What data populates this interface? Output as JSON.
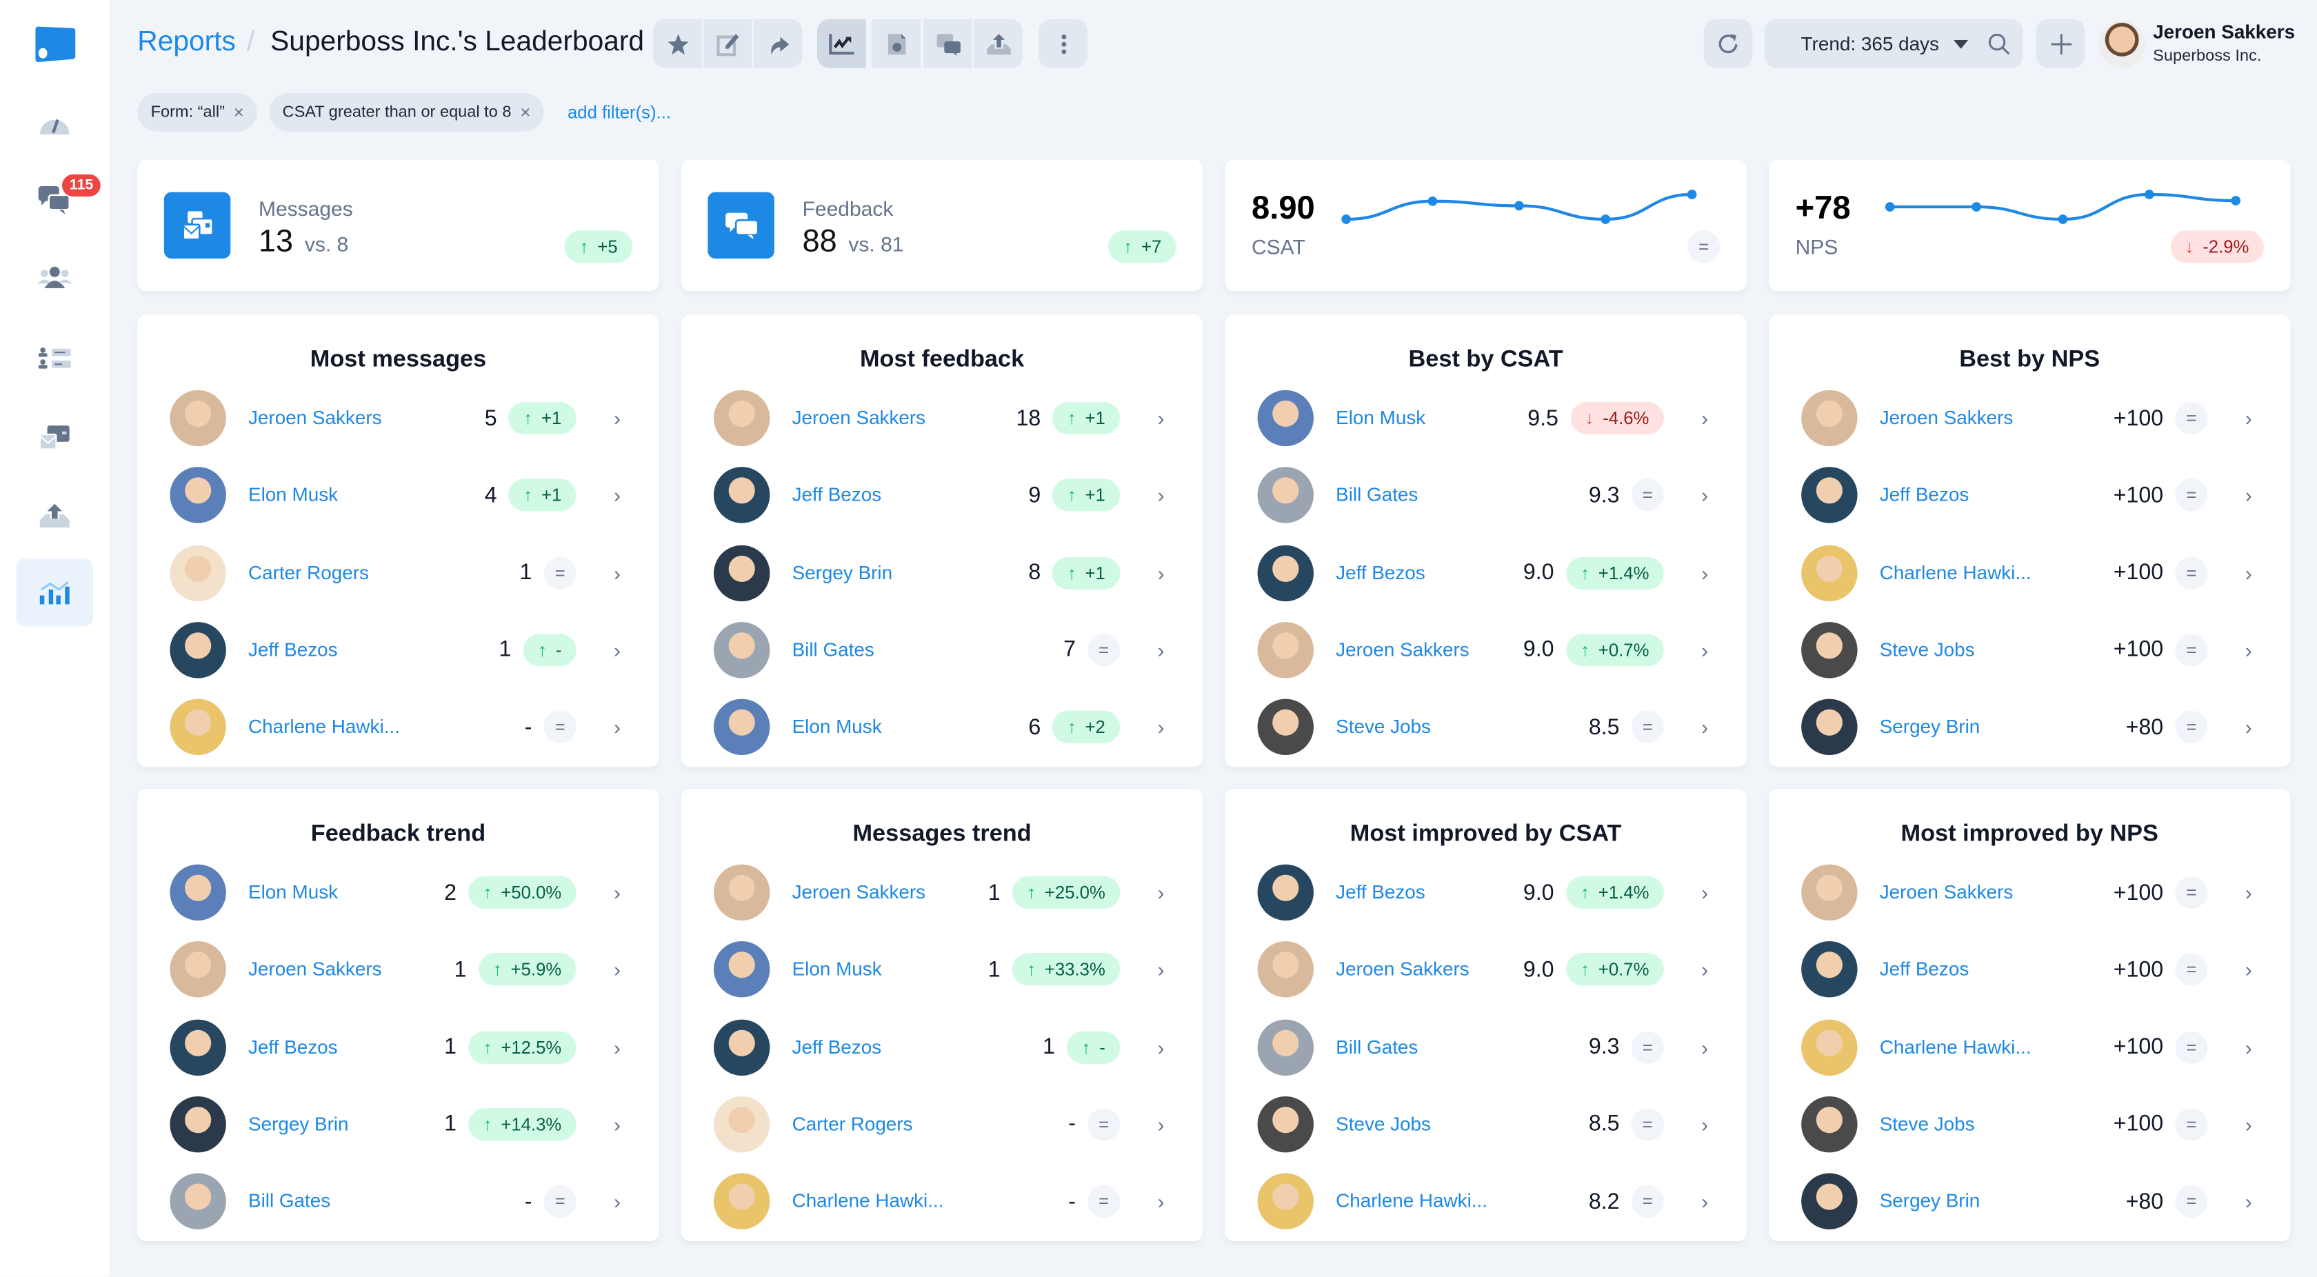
{
  "sidebar": {
    "items": [
      {
        "icon": "dashboard-gauge-icon"
      },
      {
        "icon": "conversations-icon",
        "badge": "115"
      },
      {
        "icon": "users-icon"
      },
      {
        "icon": "user-list-icon"
      },
      {
        "icon": "messages-envelope-icon"
      },
      {
        "icon": "upload-tray-icon"
      },
      {
        "icon": "reports-chart-icon",
        "active": true
      }
    ]
  },
  "header": {
    "breadcrumb_root": "Reports",
    "separator": "/",
    "title": "Superboss Inc.'s Leaderboard",
    "toolbar_icons": [
      "star-icon",
      "edit-icon",
      "share-icon",
      "trend-chart-icon",
      "report-file-icon",
      "feedback-icon",
      "export-icon",
      "more-vertical-icon"
    ],
    "trend_label": "Trend: 365 days",
    "user_name": "Jeroen Sakkers",
    "user_org": "Superboss Inc."
  },
  "filters": {
    "chips": [
      "Form: “all”",
      "CSAT greater than or equal to 8"
    ],
    "close_glyph": "×",
    "add_label": "add filter(s)..."
  },
  "kpis": {
    "messages": {
      "label": "Messages",
      "value": "13",
      "vs": "vs. 8",
      "delta": "+5",
      "dir": "up"
    },
    "feedback": {
      "label": "Feedback",
      "value": "88",
      "vs": "vs. 81",
      "delta": "+7",
      "dir": "up"
    },
    "csat": {
      "label": "CSAT",
      "value": "8.90",
      "dir": "eq",
      "trend": [
        8.85,
        8.93,
        8.91,
        8.85,
        8.96
      ]
    },
    "nps": {
      "label": "NPS",
      "value": "+78",
      "delta": "-2.9%",
      "dir": "down",
      "trend": [
        78,
        78,
        74,
        82,
        80
      ]
    }
  },
  "leaderboards": [
    {
      "title": "Most messages",
      "rows": [
        {
          "name": "Jeroen Sakkers",
          "value": "5",
          "delta": "+1",
          "dir": "up"
        },
        {
          "name": "Elon Musk",
          "value": "4",
          "delta": "+1",
          "dir": "up"
        },
        {
          "name": "Carter Rogers",
          "value": "1",
          "delta": "",
          "dir": "eq"
        },
        {
          "name": "Jeff Bezos",
          "value": "1",
          "delta": "-",
          "dir": "up"
        },
        {
          "name": "Charlene Hawki...",
          "value": "-",
          "delta": "",
          "dir": "eq"
        }
      ]
    },
    {
      "title": "Most feedback",
      "rows": [
        {
          "name": "Jeroen Sakkers",
          "value": "18",
          "delta": "+1",
          "dir": "up"
        },
        {
          "name": "Jeff Bezos",
          "value": "9",
          "delta": "+1",
          "dir": "up"
        },
        {
          "name": "Sergey Brin",
          "value": "8",
          "delta": "+1",
          "dir": "up"
        },
        {
          "name": "Bill Gates",
          "value": "7",
          "delta": "",
          "dir": "eq"
        },
        {
          "name": "Elon Musk",
          "value": "6",
          "delta": "+2",
          "dir": "up"
        }
      ]
    },
    {
      "title": "Best by CSAT",
      "rows": [
        {
          "name": "Elon Musk",
          "value": "9.5",
          "delta": "-4.6%",
          "dir": "down"
        },
        {
          "name": "Bill Gates",
          "value": "9.3",
          "delta": "",
          "dir": "eq"
        },
        {
          "name": "Jeff Bezos",
          "value": "9.0",
          "delta": "+1.4%",
          "dir": "up"
        },
        {
          "name": "Jeroen Sakkers",
          "value": "9.0",
          "delta": "+0.7%",
          "dir": "up"
        },
        {
          "name": "Steve Jobs",
          "value": "8.5",
          "delta": "",
          "dir": "eq"
        }
      ]
    },
    {
      "title": "Best by NPS",
      "rows": [
        {
          "name": "Jeroen Sakkers",
          "value": "+100",
          "delta": "",
          "dir": "eq"
        },
        {
          "name": "Jeff Bezos",
          "value": "+100",
          "delta": "",
          "dir": "eq"
        },
        {
          "name": "Charlene Hawki...",
          "value": "+100",
          "delta": "",
          "dir": "eq"
        },
        {
          "name": "Steve Jobs",
          "value": "+100",
          "delta": "",
          "dir": "eq"
        },
        {
          "name": "Sergey Brin",
          "value": "+80",
          "delta": "",
          "dir": "eq"
        }
      ]
    },
    {
      "title": "Feedback trend",
      "rows": [
        {
          "name": "Elon Musk",
          "value": "2",
          "delta": "+50.0%",
          "dir": "up"
        },
        {
          "name": "Jeroen Sakkers",
          "value": "1",
          "delta": "+5.9%",
          "dir": "up"
        },
        {
          "name": "Jeff Bezos",
          "value": "1",
          "delta": "+12.5%",
          "dir": "up"
        },
        {
          "name": "Sergey Brin",
          "value": "1",
          "delta": "+14.3%",
          "dir": "up"
        },
        {
          "name": "Bill Gates",
          "value": "-",
          "delta": "",
          "dir": "eq"
        }
      ]
    },
    {
      "title": "Messages trend",
      "rows": [
        {
          "name": "Jeroen Sakkers",
          "value": "1",
          "delta": "+25.0%",
          "dir": "up"
        },
        {
          "name": "Elon Musk",
          "value": "1",
          "delta": "+33.3%",
          "dir": "up"
        },
        {
          "name": "Jeff Bezos",
          "value": "1",
          "delta": "-",
          "dir": "up"
        },
        {
          "name": "Carter Rogers",
          "value": "-",
          "delta": "",
          "dir": "eq"
        },
        {
          "name": "Charlene Hawki...",
          "value": "-",
          "delta": "",
          "dir": "eq"
        }
      ]
    },
    {
      "title": "Most improved by CSAT",
      "rows": [
        {
          "name": "Jeff Bezos",
          "value": "9.0",
          "delta": "+1.4%",
          "dir": "up"
        },
        {
          "name": "Jeroen Sakkers",
          "value": "9.0",
          "delta": "+0.7%",
          "dir": "up"
        },
        {
          "name": "Bill Gates",
          "value": "9.3",
          "delta": "",
          "dir": "eq"
        },
        {
          "name": "Steve Jobs",
          "value": "8.5",
          "delta": "",
          "dir": "eq"
        },
        {
          "name": "Charlene Hawki...",
          "value": "8.2",
          "delta": "",
          "dir": "eq"
        }
      ]
    },
    {
      "title": "Most improved by NPS",
      "rows": [
        {
          "name": "Jeroen Sakkers",
          "value": "+100",
          "delta": "",
          "dir": "eq"
        },
        {
          "name": "Jeff Bezos",
          "value": "+100",
          "delta": "",
          "dir": "eq"
        },
        {
          "name": "Charlene Hawki...",
          "value": "+100",
          "delta": "",
          "dir": "eq"
        },
        {
          "name": "Steve Jobs",
          "value": "+100",
          "delta": "",
          "dir": "eq"
        },
        {
          "name": "Sergey Brin",
          "value": "+80",
          "delta": "",
          "dir": "eq"
        }
      ]
    }
  ],
  "glyphs": {
    "up": "↑",
    "down": "↓",
    "eq": "=",
    "chevron": "›"
  },
  "colors": {
    "accent": "#1e88e5",
    "up_bg": "#d1fae5",
    "down_bg": "#fee2e2",
    "badge": "#ef4444"
  },
  "avatar_colors": {
    "Jeroen Sakkers": "#d9b99b",
    "Elon Musk": "#5b7fb8",
    "Carter Rogers": "#f3e1cc",
    "Jeff Bezos": "#274760",
    "Charlene Hawki...": "#e9c46a",
    "Sergey Brin": "#2b3a4a",
    "Bill Gates": "#9aa5b1",
    "Steve Jobs": "#4a4a4a"
  }
}
